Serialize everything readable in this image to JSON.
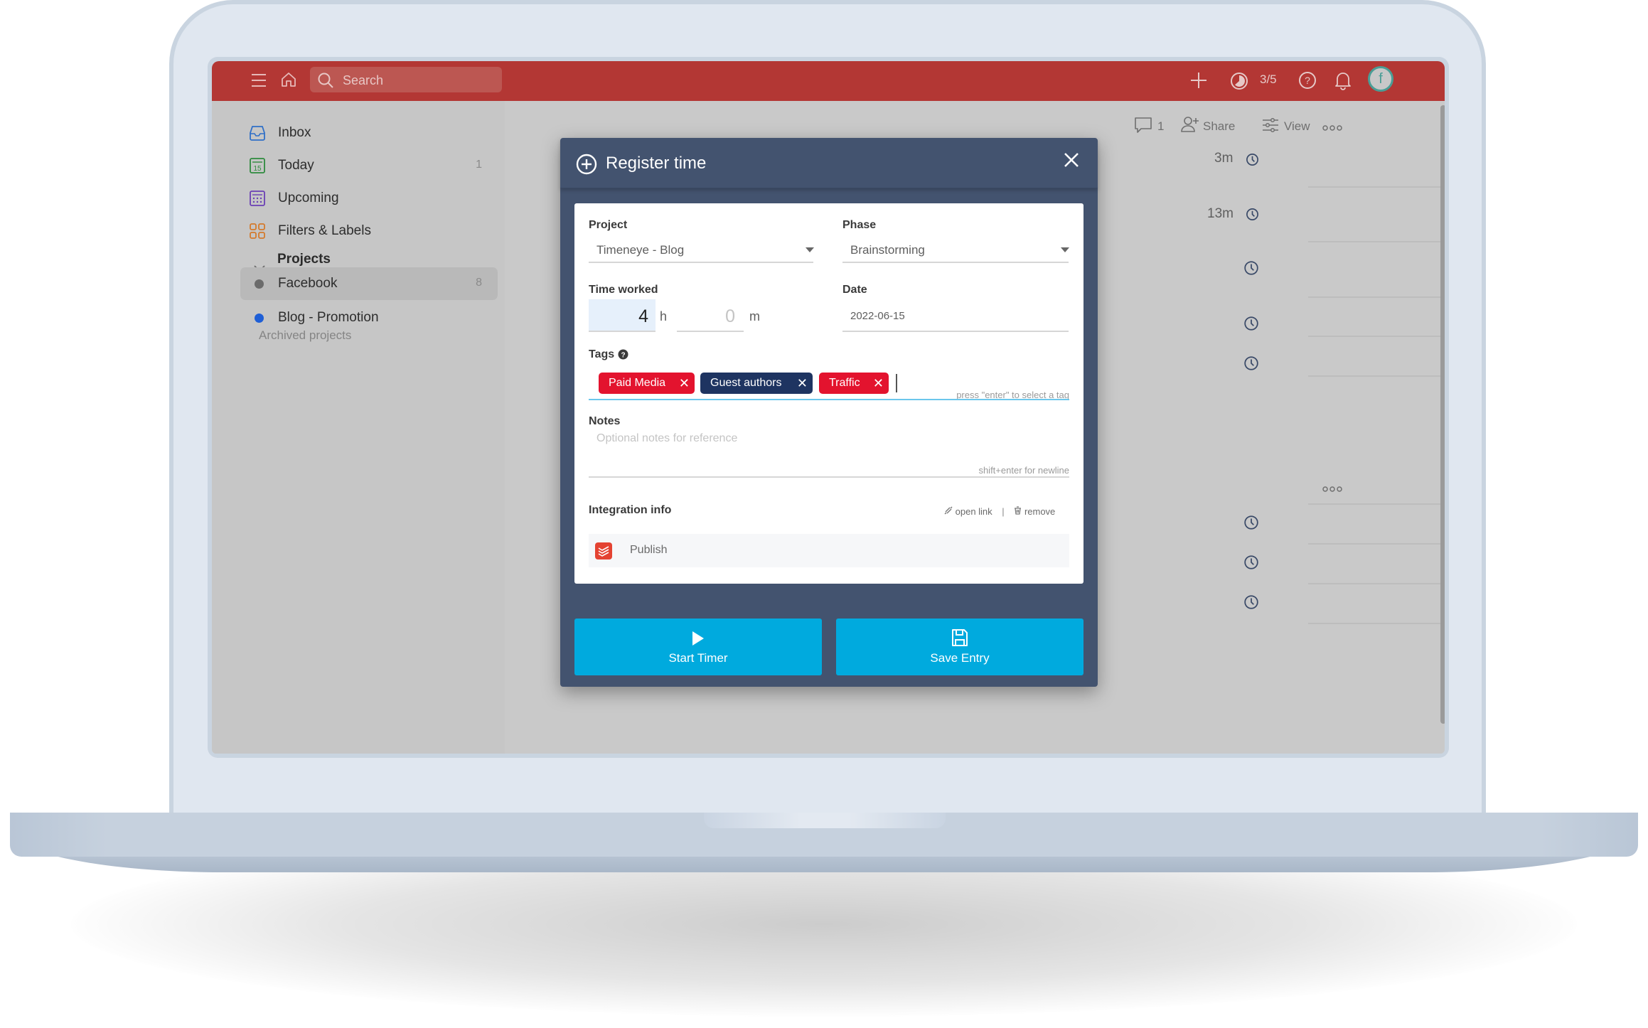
{
  "topbar": {
    "search_placeholder": "Search",
    "focus_count": "3/5",
    "avatar_initial": "f",
    "color": "#b33734"
  },
  "sidebar": {
    "items": [
      {
        "label": "Inbox",
        "icon": "inbox-icon",
        "count": ""
      },
      {
        "label": "Today",
        "icon": "calendar-today-icon",
        "count": "1"
      },
      {
        "label": "Upcoming",
        "icon": "calendar-upcoming-icon",
        "count": ""
      },
      {
        "label": "Filters & Labels",
        "icon": "filters-grid-icon",
        "count": ""
      }
    ],
    "projects_header": "Projects",
    "projects": [
      {
        "label": "Facebook",
        "count": "8",
        "color": "#6b6b6b"
      },
      {
        "label": "Blog - Promotion",
        "count": "",
        "color": "#1f5fd6"
      }
    ],
    "archived_label": "Archived projects"
  },
  "main": {
    "comments_count": "1",
    "share_label": "Share",
    "view_label": "View",
    "durations": [
      "3m",
      "13m",
      "",
      "",
      "",
      "",
      "",
      ""
    ]
  },
  "modal": {
    "title": "Register time",
    "project_label": "Project",
    "project_value": "Timeneye - Blog",
    "phase_label": "Phase",
    "phase_value": "Brainstorming",
    "time_label": "Time worked",
    "hours_value": "4",
    "hours_unit": "h",
    "minutes_value": "0",
    "minutes_unit": "m",
    "date_label": "Date",
    "date_value": "2022-06-15",
    "tags_label": "Tags",
    "tags": [
      {
        "label": "Paid Media",
        "color": "#e3132e"
      },
      {
        "label": "Guest authors",
        "color": "#1e3461"
      },
      {
        "label": "Traffic",
        "color": "#e3132e"
      }
    ],
    "tags_hint": "press \"enter\" to select a tag",
    "notes_label": "Notes",
    "notes_placeholder": "Optional notes for reference",
    "notes_hint": "shift+enter for newline",
    "integration_label": "Integration info",
    "open_link_label": "open link",
    "separator": "|",
    "remove_label": "remove",
    "integration_item": "Publish",
    "start_timer_label": "Start Timer",
    "save_entry_label": "Save Entry",
    "button_color": "#00aade"
  }
}
